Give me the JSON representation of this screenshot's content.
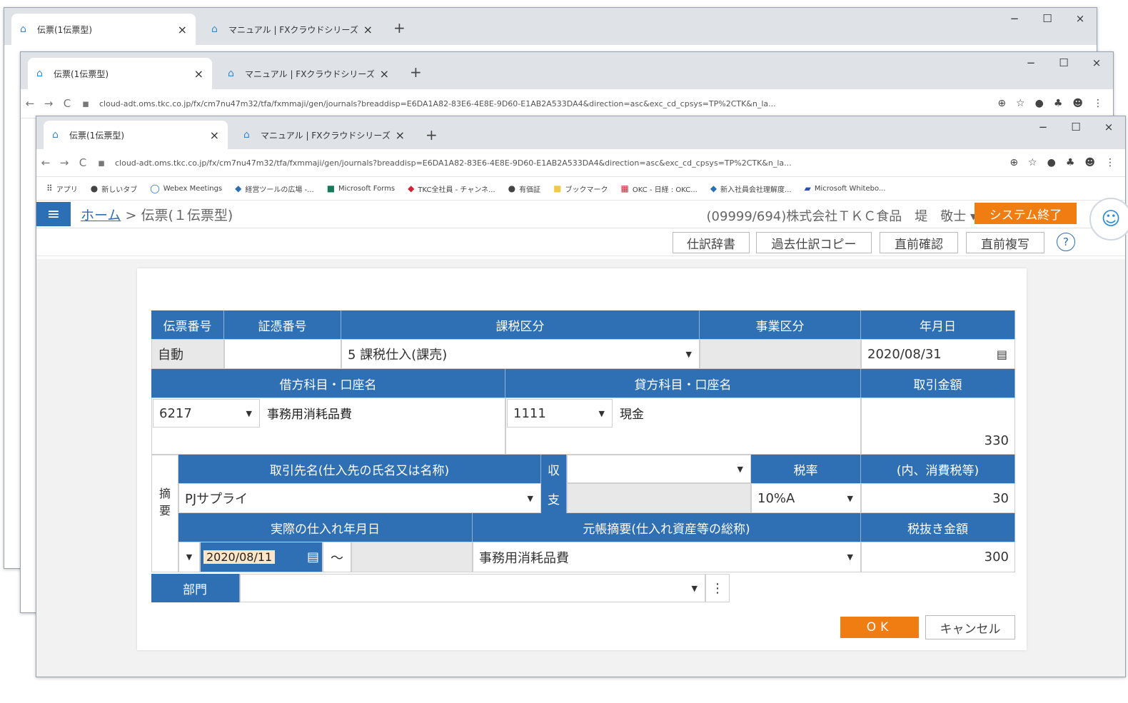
{
  "browser": {
    "tabs": [
      {
        "title": "伝票(1伝票型)",
        "close": "×"
      },
      {
        "title": "マニュアル | FXクラウドシリーズ",
        "close": "×"
      }
    ],
    "new_tab": "+",
    "window_controls": {
      "minimize": "−",
      "maximize": "☐",
      "close": "×"
    },
    "address_url": "cloud-adt.oms.tkc.co.jp/fx/cm7nu47m32/tfa/fxmmaji/gen/journals?breaddisp=E6DA1A82-83E6-4E8E-9D60-E1AB2A533DA4&direction=asc&exc_cd_cpsys=TP%2CTK&n_la...",
    "bookmarks": [
      "アプリ",
      "新しいタブ",
      "Webex Meetings",
      "経営ツールの広場 -...",
      "Microsoft Forms",
      "TKC全社員 - チャンネ...",
      "有価証",
      "ブックマーク",
      "OKC - 日経 : OKC...",
      "新入社員会社理解度...",
      "Microsoft Whitebo..."
    ]
  },
  "app": {
    "breadcrumb_home": "ホーム",
    "breadcrumb_sep": " > ",
    "breadcrumb_current": "伝票(１伝票型)",
    "user": "(09999/694)株式会社ＴＫＣ食品　堤　敬士 ▾",
    "system_end": "システム終了",
    "toolbar": [
      "仕訳辞書",
      "過去仕訳コピー",
      "直前確認",
      "直前複写"
    ],
    "help": "?"
  },
  "form": {
    "headers1": {
      "denpyo_no": "伝票番号",
      "shoho_no": "証憑番号",
      "kazei": "課税区分",
      "jigyo": "事業区分",
      "date": "年月日"
    },
    "row1": {
      "denpyo_no": "自動",
      "shoho_no": "",
      "kazei": "5 課税仕入(課売)",
      "jigyo": "",
      "date": "2020/08/31"
    },
    "headers2": {
      "debit": "借方科目・口座名",
      "credit": "貸方科目・口座名",
      "amount": "取引金額"
    },
    "row2": {
      "debit_code": "6217",
      "debit_name": "事務用消耗品費",
      "credit_code": "1111",
      "credit_name": "現金",
      "amount": "330"
    },
    "tekiyo_label": "摘要",
    "headers3": {
      "partner": "取引先名(仕入先の氏名又は名称)",
      "shu": "収",
      "rate": "税率",
      "tax": "(内、消費税等)"
    },
    "row3": {
      "partner": "PJサプライ",
      "shi": "支",
      "rate": "10%A",
      "tax": "30"
    },
    "headers4": {
      "actual_date": "実際の仕入れ年月日",
      "ledger": "元帳摘要(仕入れ資産等の総称)",
      "net": "税抜き金額"
    },
    "row4": {
      "actual_date": "2020/08/11",
      "tilde": "～",
      "ledger": "事務用消耗品費",
      "net": "300"
    },
    "dept_label": "部門",
    "ok": "OK",
    "cancel": "キャンセル"
  }
}
